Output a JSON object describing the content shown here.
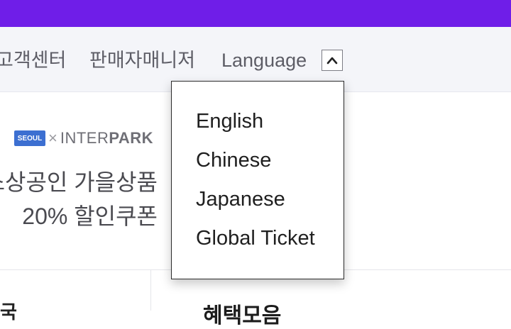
{
  "colors": {
    "brand_bar": "#6f1ee8",
    "utility_bg": "#f4f5f9",
    "link_text": "#5d5d66"
  },
  "utility": {
    "customer_center": "고객센터",
    "seller_manager": "판매자매니저",
    "language_label": "Language",
    "language_toggle_icon": "chevron-up-icon"
  },
  "language_menu": {
    "items": [
      "English",
      "Chinese",
      "Japanese",
      "Global Ticket"
    ]
  },
  "banner": {
    "partner_logo": "SEOUL",
    "collab_times": "×",
    "interpark_inter": "INTER",
    "interpark_park": "PARK",
    "line1": "소상공인 가을상품",
    "line2": "20% 할인쿠폰"
  },
  "bottom": {
    "left_text": "국",
    "heading": "혜택모음"
  }
}
